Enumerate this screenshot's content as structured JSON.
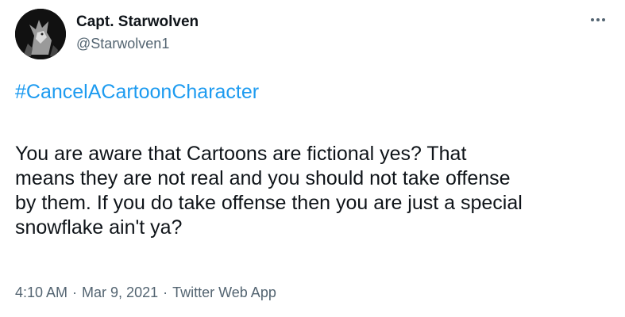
{
  "tweet": {
    "avatar_icon": "wolf-avatar-icon",
    "author_name": "Capt. Starwolven",
    "author_handle": "@Starwolven1",
    "more_icon": "more-options-icon",
    "hashtag": "#CancelACartoonCharacter",
    "body_lines": [
      "You are aware that Cartoons are fictional yes? That",
      "means they are not real and you should not take offense",
      "by them. If you do take offense then you are just a special",
      "snowflake ain't ya?"
    ],
    "time": "4:10 AM",
    "date": "Mar 9, 2021",
    "source": "Twitter Web App",
    "separator": "·"
  },
  "colors": {
    "link": "#1d9bf0",
    "text": "#0f1419",
    "secondary": "#536471"
  }
}
